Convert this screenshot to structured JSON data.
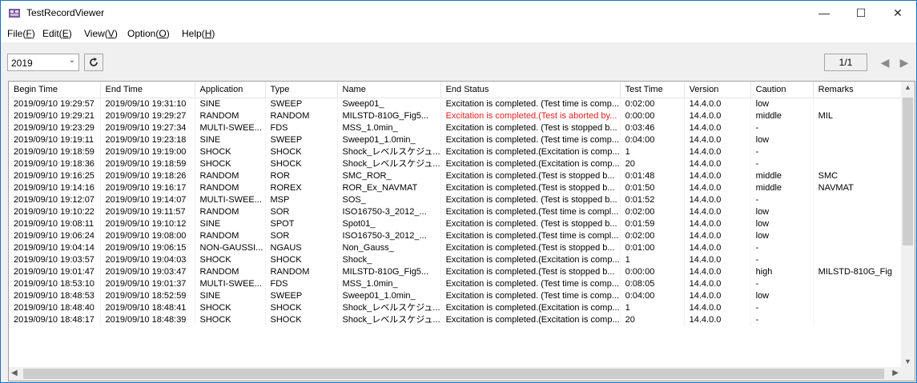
{
  "window": {
    "title": "TestRecordViewer",
    "minimize": "—",
    "maximize": "☐",
    "close": "✕"
  },
  "menu": [
    {
      "pre": "File(",
      "key": "F",
      "post": ")"
    },
    {
      "pre": "Edit(",
      "key": "E",
      "post": ")"
    },
    {
      "pre": "View(",
      "key": "V",
      "post": ")"
    },
    {
      "pre": "Option(",
      "key": "O",
      "post": ")"
    },
    {
      "pre": "Help(",
      "key": "H",
      "post": ")"
    }
  ],
  "toolbar": {
    "year": "2019",
    "page": "1/1",
    "prev": "◀",
    "next": "▶"
  },
  "columns": [
    "Begin Time",
    "End Time",
    "Application",
    "Type",
    "Name",
    "End Status",
    "Test Time",
    "Version",
    "Caution",
    "Remarks"
  ],
  "rows": [
    [
      "2019/09/10 19:29:57",
      "2019/09/10 19:31:10",
      "SINE",
      "SWEEP",
      "Sweep01_",
      "Excitation is completed. (Test time is comp...",
      "0:02:00",
      "14.4.0.0",
      "low",
      ""
    ],
    [
      "2019/09/10 19:29:21",
      "2019/09/10 19:29:27",
      "RANDOM",
      "RANDOM",
      "MILSTD-810G_Fig5...",
      "Excitation is completed.(Test is aborted by...",
      "0:00:00",
      "14.4.0.0",
      "middle",
      "MIL"
    ],
    [
      "2019/09/10 19:23:29",
      "2019/09/10 19:27:34",
      "MULTI-SWEE...",
      "FDS",
      "MSS_1.0min_",
      "Excitation is completed. (Test is stopped b...",
      "0:03:46",
      "14.4.0.0",
      "-",
      ""
    ],
    [
      "2019/09/10 19:19:11",
      "2019/09/10 19:23:18",
      "SINE",
      "SWEEP",
      "Sweep01_1.0min_",
      "Excitation is completed. (Test time is comp...",
      "0:04:00",
      "14.4.0.0",
      "low",
      ""
    ],
    [
      "2019/09/10 19:18:59",
      "2019/09/10 19:19:00",
      "SHOCK",
      "SHOCK",
      "Shock_レベルスケジュ...",
      "Excitation is completed.(Excitation is comp...",
      "1",
      "14.4.0.0",
      "-",
      ""
    ],
    [
      "2019/09/10 19:18:36",
      "2019/09/10 19:18:59",
      "SHOCK",
      "SHOCK",
      "Shock_レベルスケジュ...",
      "Excitation is completed.(Excitation is comp...",
      "20",
      "14.4.0.0",
      "-",
      ""
    ],
    [
      "2019/09/10 19:16:25",
      "2019/09/10 19:18:26",
      "RANDOM",
      "ROR",
      "SMC_ROR_",
      "Excitation is completed.(Test is stopped b...",
      "0:01:48",
      "14.4.0.0",
      "middle",
      "SMC"
    ],
    [
      "2019/09/10 19:14:16",
      "2019/09/10 19:16:17",
      "RANDOM",
      "ROREX",
      "ROR_Ex_NAVMAT",
      "Excitation is completed.(Test is stopped b...",
      "0:01:50",
      "14.4.0.0",
      "middle",
      "NAVMAT"
    ],
    [
      "2019/09/10 19:12:07",
      "2019/09/10 19:14:07",
      "MULTI-SWEE...",
      "MSP",
      "SOS_",
      "Excitation is completed. (Test is stopped b...",
      "0:01:52",
      "14.4.0.0",
      "-",
      ""
    ],
    [
      "2019/09/10 19:10:22",
      "2019/09/10 19:11:57",
      "RANDOM",
      "SOR",
      "ISO16750-3_2012_...",
      "Excitation is completed.(Test time is compl...",
      "0:02:00",
      "14.4.0.0",
      "low",
      ""
    ],
    [
      "2019/09/10 19:08:11",
      "2019/09/10 19:10:12",
      "SINE",
      "SPOT",
      "Spot01_",
      "Excitation is completed. (Test is stopped b...",
      "0:01:59",
      "14.4.0.0",
      "low",
      ""
    ],
    [
      "2019/09/10 19:06:24",
      "2019/09/10 19:08:00",
      "RANDOM",
      "SOR",
      "ISO16750-3_2012_...",
      "Excitation is completed.(Test time is compl...",
      "0:02:00",
      "14.4.0.0",
      "low",
      ""
    ],
    [
      "2019/09/10 19:04:14",
      "2019/09/10 19:06:15",
      "NON-GAUSSI...",
      "NGAUS",
      "Non_Gauss_",
      "Excitation is completed.(Test is stopped b...",
      "0:01:00",
      "14.4.0.0",
      "-",
      ""
    ],
    [
      "2019/09/10 19:03:57",
      "2019/09/10 19:04:03",
      "SHOCK",
      "SHOCK",
      "Shock_",
      "Excitation is completed.(Excitation is comp...",
      "1",
      "14.4.0.0",
      "-",
      ""
    ],
    [
      "2019/09/10 19:01:47",
      "2019/09/10 19:03:47",
      "RANDOM",
      "RANDOM",
      "MILSTD-810G_Fig5...",
      "Excitation is completed.(Test is stopped b...",
      "0:00:00",
      "14.4.0.0",
      "high",
      "MILSTD-810G_Fig"
    ],
    [
      "2019/09/10 18:53:10",
      "2019/09/10 19:01:37",
      "MULTI-SWEE...",
      "FDS",
      "MSS_1.0min_",
      "Excitation is completed. (Test time is comp...",
      "0:08:05",
      "14.4.0.0",
      "-",
      ""
    ],
    [
      "2019/09/10 18:48:53",
      "2019/09/10 18:52:59",
      "SINE",
      "SWEEP",
      "Sweep01_1.0min_",
      "Excitation is completed. (Test time is comp...",
      "0:04:00",
      "14.4.0.0",
      "low",
      ""
    ],
    [
      "2019/09/10 18:48:40",
      "2019/09/10 18:48:41",
      "SHOCK",
      "SHOCK",
      "Shock_レベルスケジュ...",
      "Excitation is completed.(Excitation is comp...",
      "1",
      "14.4.0.0",
      "-",
      ""
    ],
    [
      "2019/09/10 18:48:17",
      "2019/09/10 18:48:39",
      "SHOCK",
      "SHOCK",
      "Shock_レベルスケジュ...",
      "Excitation is completed.(Excitation is comp...",
      "20",
      "14.4.0.0",
      "-",
      ""
    ]
  ],
  "error_row_index": 1,
  "colors": {
    "error_text": "#e02020",
    "window_border": "#1e6fb8"
  }
}
